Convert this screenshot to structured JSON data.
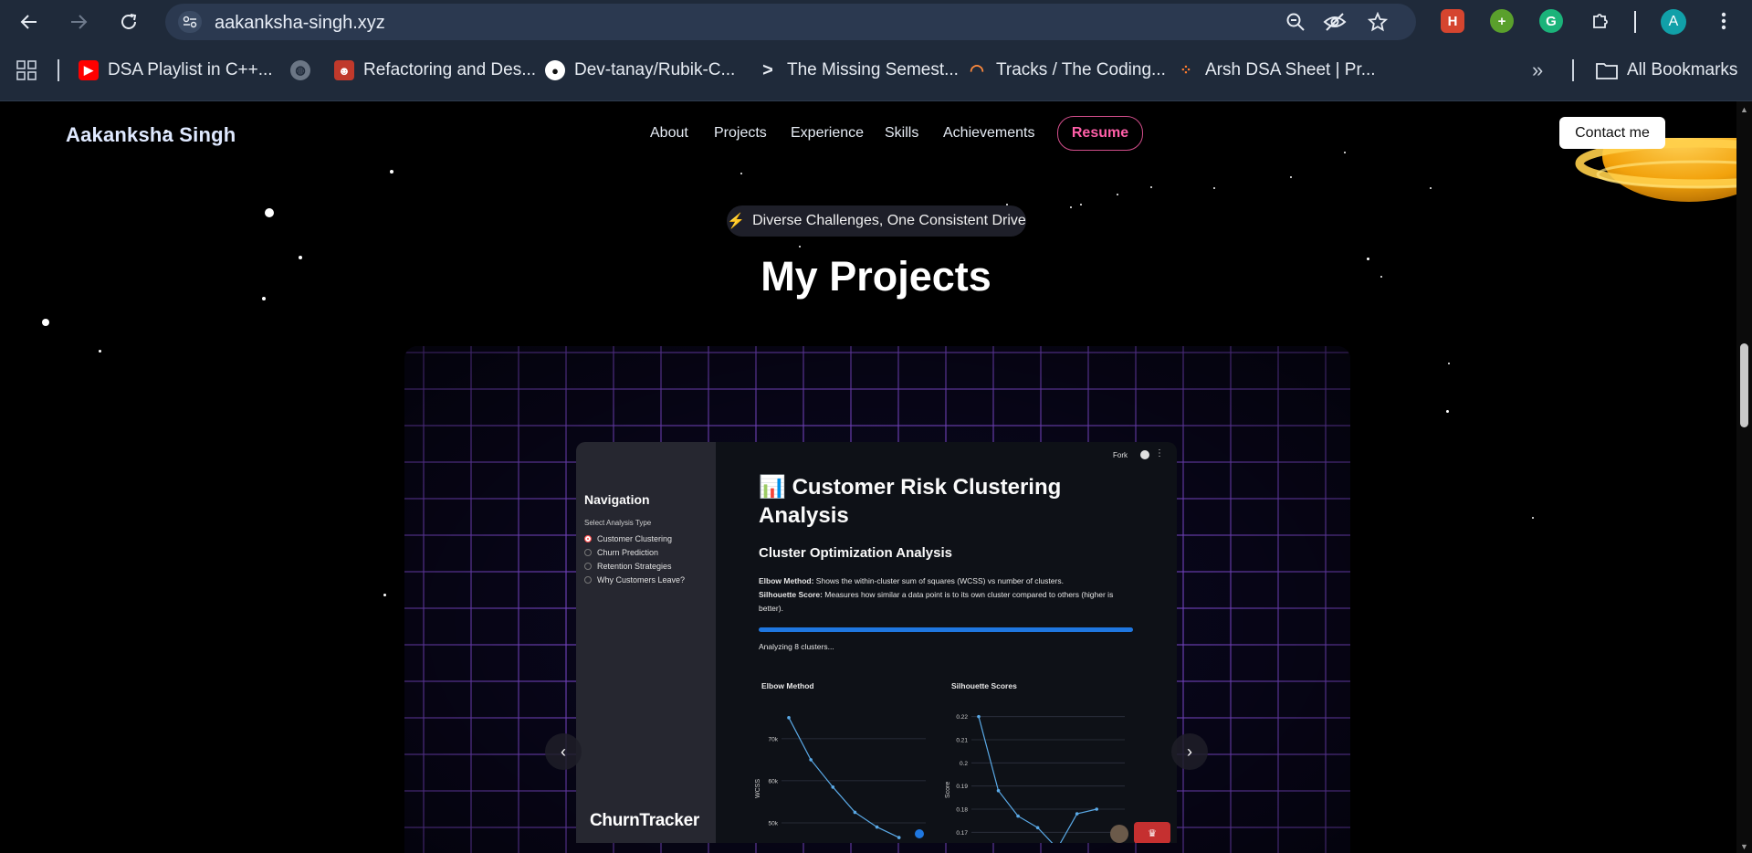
{
  "browser": {
    "url": "aakanksha-singh.xyz",
    "profile_initial": "A",
    "bookmarks": [
      {
        "label": "DSA Playlist in C++...",
        "icon": "youtube-icon"
      },
      {
        "label": "",
        "icon": "globe-icon"
      },
      {
        "label": "Refactoring and Des...",
        "icon": "raccoon-icon"
      },
      {
        "label": "Dev-tanay/Rubik-C...",
        "icon": "github-icon"
      },
      {
        "label": "The Missing Semest...",
        "icon": "terminal-icon"
      },
      {
        "label": "Tracks / The Coding...",
        "icon": "rainbow-icon"
      },
      {
        "label": "Arsh DSA Sheet | Pr...",
        "icon": "dots-icon"
      }
    ],
    "all_bookmarks": "All Bookmarks"
  },
  "site": {
    "brand": "Aakanksha Singh",
    "nav": [
      "About",
      "Projects",
      "Experience",
      "Skills",
      "Achievements"
    ],
    "resume": "Resume",
    "contact": "Contact me"
  },
  "section": {
    "badge": "Diverse Challenges, One Consistent Drive",
    "title": "My Projects"
  },
  "project": {
    "logo": "ChurnTracker",
    "topbar": {
      "fork": "Fork"
    },
    "sidebar": {
      "heading": "Navigation",
      "select_label": "Select Analysis Type",
      "options": [
        "Customer Clustering",
        "Churn Prediction",
        "Retention Strategies",
        "Why Customers Leave?"
      ],
      "selected_index": 0
    },
    "main": {
      "title_emoji": "📊",
      "title_line1": "Customer Risk Clustering",
      "title_line2": "Analysis",
      "subtitle": "Cluster Optimization Analysis",
      "elbow_term": "Elbow Method:",
      "elbow_text": " Shows the within-cluster sum of squares (WCSS) vs number of clusters.",
      "sil_term": "Silhouette Score:",
      "sil_text": " Measures how similar a data point is to its own cluster compared to others (higher is better).",
      "progress_text": "Analyzing 8 clusters...",
      "progress": 1.0
    },
    "charts": [
      {
        "type": "line",
        "title": "Elbow Method",
        "ylabel": "WCSS",
        "yticks": [
          "70k",
          "60k",
          "50k"
        ],
        "y": [
          75000,
          65000,
          58500,
          52500,
          49000,
          46500
        ]
      },
      {
        "type": "line",
        "title": "Silhouette Scores",
        "ylabel": "Score",
        "yticks": [
          "0.22",
          "0.21",
          "0.2",
          "0.19",
          "0.18",
          "0.17"
        ],
        "y": [
          0.22,
          0.188,
          0.177,
          0.172,
          0.163,
          0.178,
          0.18
        ]
      }
    ]
  },
  "colors": {
    "accent_pink": "#ff5fa8",
    "progress_blue": "#1f77e0",
    "line_blue": "#5aa9e6"
  }
}
